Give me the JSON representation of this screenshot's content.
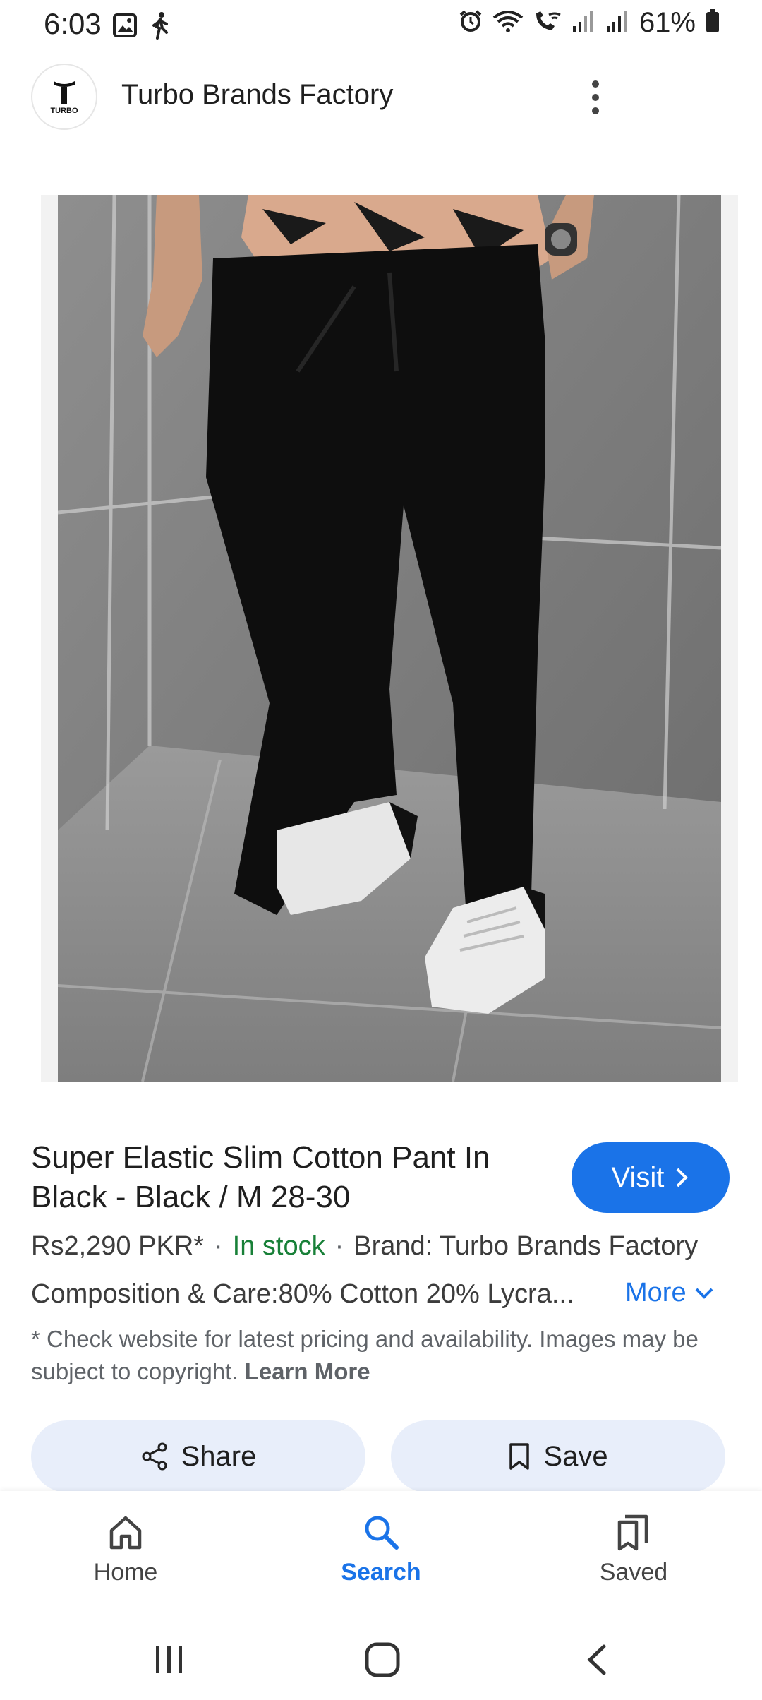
{
  "status_bar": {
    "time": "6:03",
    "battery": "61%",
    "icons": [
      "image-icon",
      "walking-icon",
      "alarm-icon",
      "wifi-icon",
      "wifi-call-icon",
      "signal-icon",
      "signal-icon",
      "battery-icon"
    ]
  },
  "header": {
    "logo_text": "TURBO",
    "title": "Turbo Brands Factory",
    "menu_icon": "more-vert-icon"
  },
  "product": {
    "title": "Super Elastic Slim Cotton Pant In Black - Black / M 28-30",
    "visit_label": "Visit",
    "price": "Rs2,290 PKR*",
    "stock": "In stock",
    "brand": "Brand: Turbo Brands Factory",
    "description": "Composition & Care:80% Cotton 20% Lycra...",
    "more_label": "More",
    "disclaimer": "* Check website for latest pricing and availability. Images may be subject to copyright.",
    "learn_more": "Learn More"
  },
  "actions": {
    "share_label": "Share",
    "save_label": "Save"
  },
  "bottom_nav": {
    "items": [
      {
        "label": "Home",
        "icon": "home-icon"
      },
      {
        "label": "Search",
        "icon": "search-icon",
        "active": true
      },
      {
        "label": "Saved",
        "icon": "saved-icon"
      }
    ]
  },
  "colors": {
    "accent": "#1a73e8",
    "in_stock": "#188038",
    "action_bg": "#e8eefa"
  }
}
